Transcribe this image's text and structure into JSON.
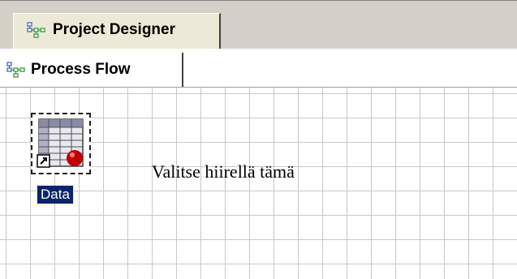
{
  "tabs": {
    "outer": {
      "label": "Project Designer",
      "icon": "process-flow-icon"
    },
    "inner": {
      "label": "Process Flow",
      "icon": "process-flow-icon"
    }
  },
  "canvas": {
    "node": {
      "label": "Data",
      "icon": "data-table-icon"
    },
    "hint": "Valitse hiirellä tämä"
  },
  "colors": {
    "tab_bar": "#d4d0c8",
    "grid_line": "#c8c8c8",
    "selection": "#0a246a"
  }
}
